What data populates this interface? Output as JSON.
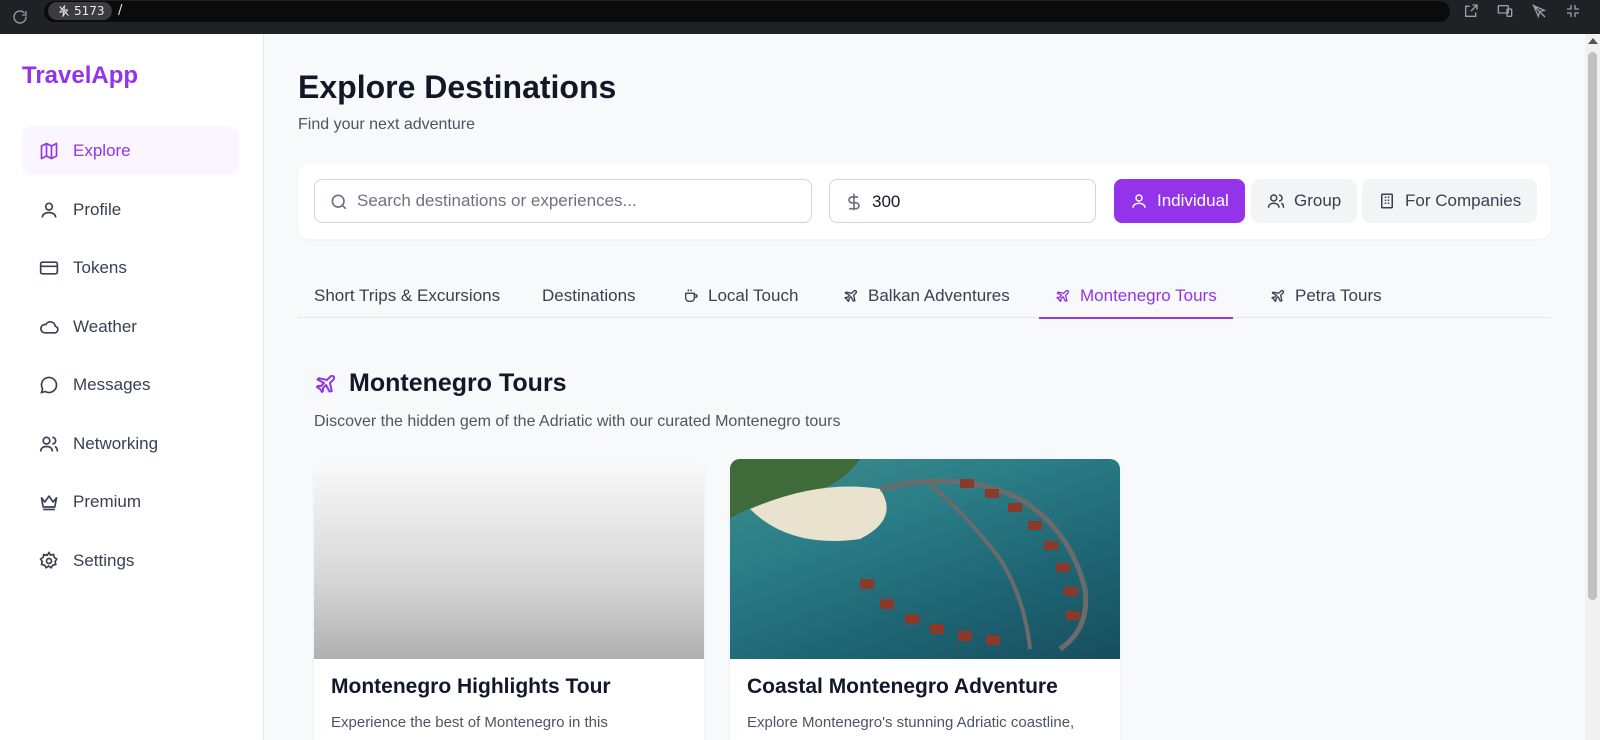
{
  "browser": {
    "port": "5173",
    "path": "/"
  },
  "sidebar": {
    "brand": "TravelApp",
    "items": [
      {
        "label": "Explore",
        "icon": "map-icon",
        "active": true
      },
      {
        "label": "Profile",
        "icon": "user-icon"
      },
      {
        "label": "Tokens",
        "icon": "credit-card-icon"
      },
      {
        "label": "Weather",
        "icon": "cloud-icon"
      },
      {
        "label": "Messages",
        "icon": "message-circle-icon"
      },
      {
        "label": "Networking",
        "icon": "users-icon"
      },
      {
        "label": "Premium",
        "icon": "crown-icon"
      },
      {
        "label": "Settings",
        "icon": "gear-icon"
      }
    ]
  },
  "header": {
    "title": "Explore Destinations",
    "subtitle": "Find your next adventure"
  },
  "filters": {
    "search_placeholder": "Search destinations or experiences...",
    "budget_value": "300",
    "segments": [
      {
        "label": "Individual",
        "icon": "user-icon",
        "active": true
      },
      {
        "label": "Group",
        "icon": "users-icon"
      },
      {
        "label": "For Companies",
        "icon": "building-icon"
      }
    ]
  },
  "tabs": [
    {
      "label": "Short Trips & Excursions"
    },
    {
      "label": "Destinations"
    },
    {
      "label": "Local Touch",
      "icon": "coffee-icon"
    },
    {
      "label": "Balkan Adventures",
      "icon": "plane-icon"
    },
    {
      "label": "Montenegro Tours",
      "icon": "plane-icon",
      "active": true
    },
    {
      "label": "Petra Tours",
      "icon": "plane-icon"
    }
  ],
  "section": {
    "title": "Montenegro Tours",
    "description": "Discover the hidden gem of the Adriatic with our curated Montenegro tours"
  },
  "cards": [
    {
      "title": "Montenegro Highlights Tour",
      "description": "Experience the best of Montenegro in this"
    },
    {
      "title": "Coastal Montenegro Adventure",
      "description": "Explore Montenegro's stunning Adriatic coastline,"
    }
  ],
  "colors": {
    "accent": "#9333ea",
    "accent_light": "#faf5ff"
  }
}
